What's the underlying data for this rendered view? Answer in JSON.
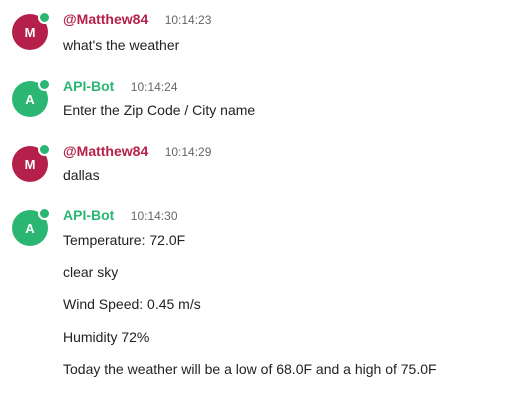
{
  "colors": {
    "user": "#b5204a",
    "bot": "#2bb673",
    "online": "#2bb673"
  },
  "messages": [
    {
      "author": "@Matthew84",
      "initial": "M",
      "time": "10:14:23",
      "role": "user",
      "lines": [
        "what's the weather"
      ]
    },
    {
      "author": "API-Bot",
      "initial": "A",
      "time": "10:14:24",
      "role": "bot",
      "lines": [
        "Enter the Zip Code / City name"
      ]
    },
    {
      "author": "@Matthew84",
      "initial": "M",
      "time": "10:14:29",
      "role": "user",
      "lines": [
        "dallas"
      ]
    },
    {
      "author": "API-Bot",
      "initial": "A",
      "time": "10:14:30",
      "role": "bot",
      "lines": [
        "Temperature: 72.0F",
        "clear sky",
        "Wind Speed: 0.45 m/s",
        "Humidity 72%",
        "Today the weather will be a low of 68.0F and a high of 75.0F"
      ]
    }
  ]
}
